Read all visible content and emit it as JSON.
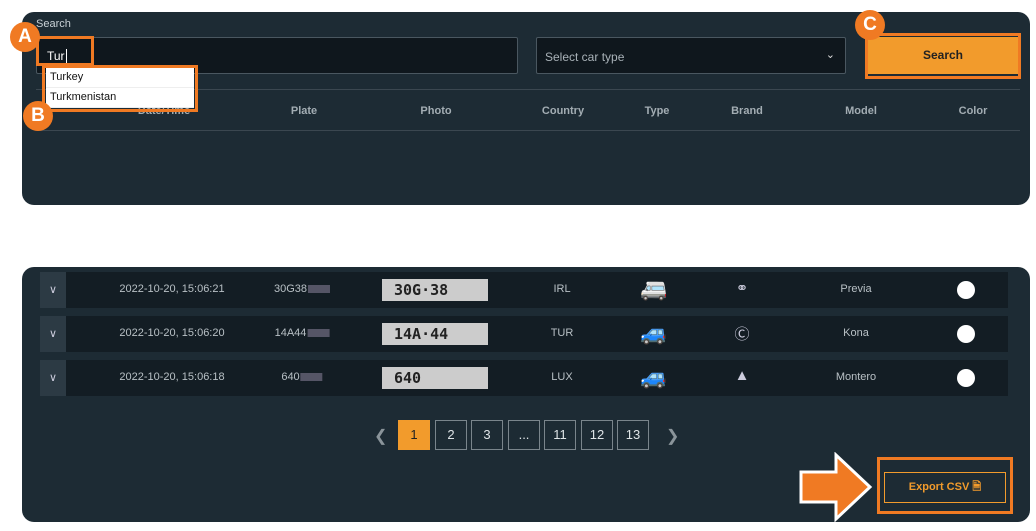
{
  "search": {
    "label": "Search",
    "value": "Tur",
    "suggestions": [
      "Turkey",
      "Turkmenistan"
    ],
    "car_type_placeholder": "Select car type",
    "button": "Search"
  },
  "columns": [
    "Date/Time",
    "Plate",
    "Photo",
    "Country",
    "Type",
    "Brand",
    "Model",
    "Color"
  ],
  "rows": [
    {
      "datetime": "2022-10-20, 15:06:21",
      "plate": "30G38",
      "photo": "30G·38",
      "country": "IRL",
      "type": "van-icon",
      "brand": "toyota-logo",
      "model": "Previa",
      "color": "#ffffff"
    },
    {
      "datetime": "2022-10-20, 15:06:20",
      "plate": "14A44",
      "photo": "14A·44",
      "country": "TUR",
      "type": "suv-icon",
      "brand": "hyundai-logo",
      "model": "Kona",
      "color": "#ffffff"
    },
    {
      "datetime": "2022-10-20, 15:06:18",
      "plate": "640",
      "photo": "640",
      "country": "LUX",
      "type": "suv-icon",
      "brand": "mitsubishi-logo",
      "model": "Montero",
      "color": "#ffffff"
    }
  ],
  "pagination": {
    "pages": [
      "1",
      "2",
      "3",
      "...",
      "11",
      "12",
      "13"
    ],
    "current": "1"
  },
  "export": "Export CSV",
  "annotations": [
    "A",
    "B",
    "C"
  ],
  "colors": {
    "accent": "#f29b2c",
    "highlight": "#f07a23",
    "panel": "#1d2b34"
  }
}
